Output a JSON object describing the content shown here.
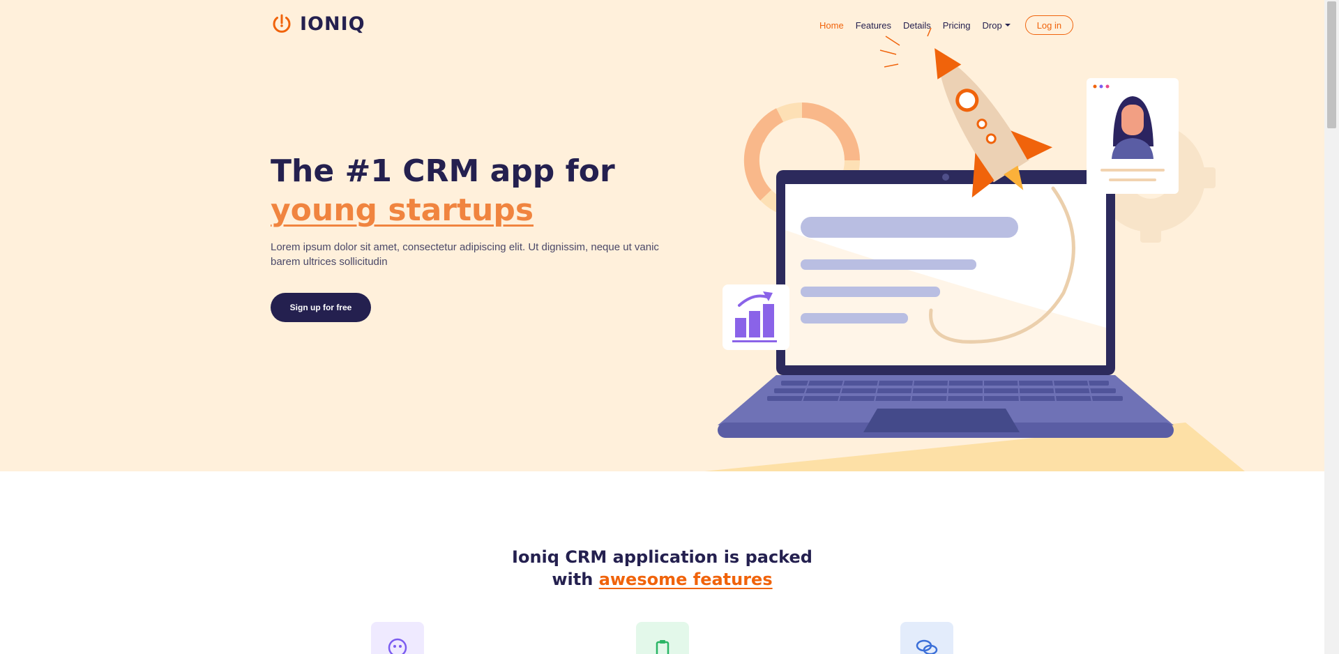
{
  "brand": {
    "name": "IONIQ",
    "accent": "#f0630b",
    "dark": "#24204f",
    "hero_bg": "#fff0db"
  },
  "nav": {
    "items": [
      {
        "label": "Home",
        "active": true
      },
      {
        "label": "Features"
      },
      {
        "label": "Details"
      },
      {
        "label": "Pricing"
      }
    ],
    "dropdown_label": "Drop",
    "login_label": "Log in"
  },
  "hero": {
    "title_line1": "The #1 CRM app for",
    "title_line2": "young startups",
    "subtitle": "Lorem ipsum dolor sit amet, consectetur adipiscing elit. Ut dignissim, neque ut vanic barem ultrices sollicitudin",
    "cta_label": "Sign up for free"
  },
  "features": {
    "title_line1": "Ioniq CRM application is packed",
    "title_prefix": "with ",
    "title_accent": "awesome features",
    "cards": [
      {
        "icon": "smile-icon",
        "bg": "#efeaff",
        "color": "#7b5cf0"
      },
      {
        "icon": "clipboard-icon",
        "bg": "#e3f8ea",
        "color": "#2bb566"
      },
      {
        "icon": "chat-icon",
        "bg": "#e3ecfb",
        "color": "#3b6fd8"
      }
    ]
  }
}
